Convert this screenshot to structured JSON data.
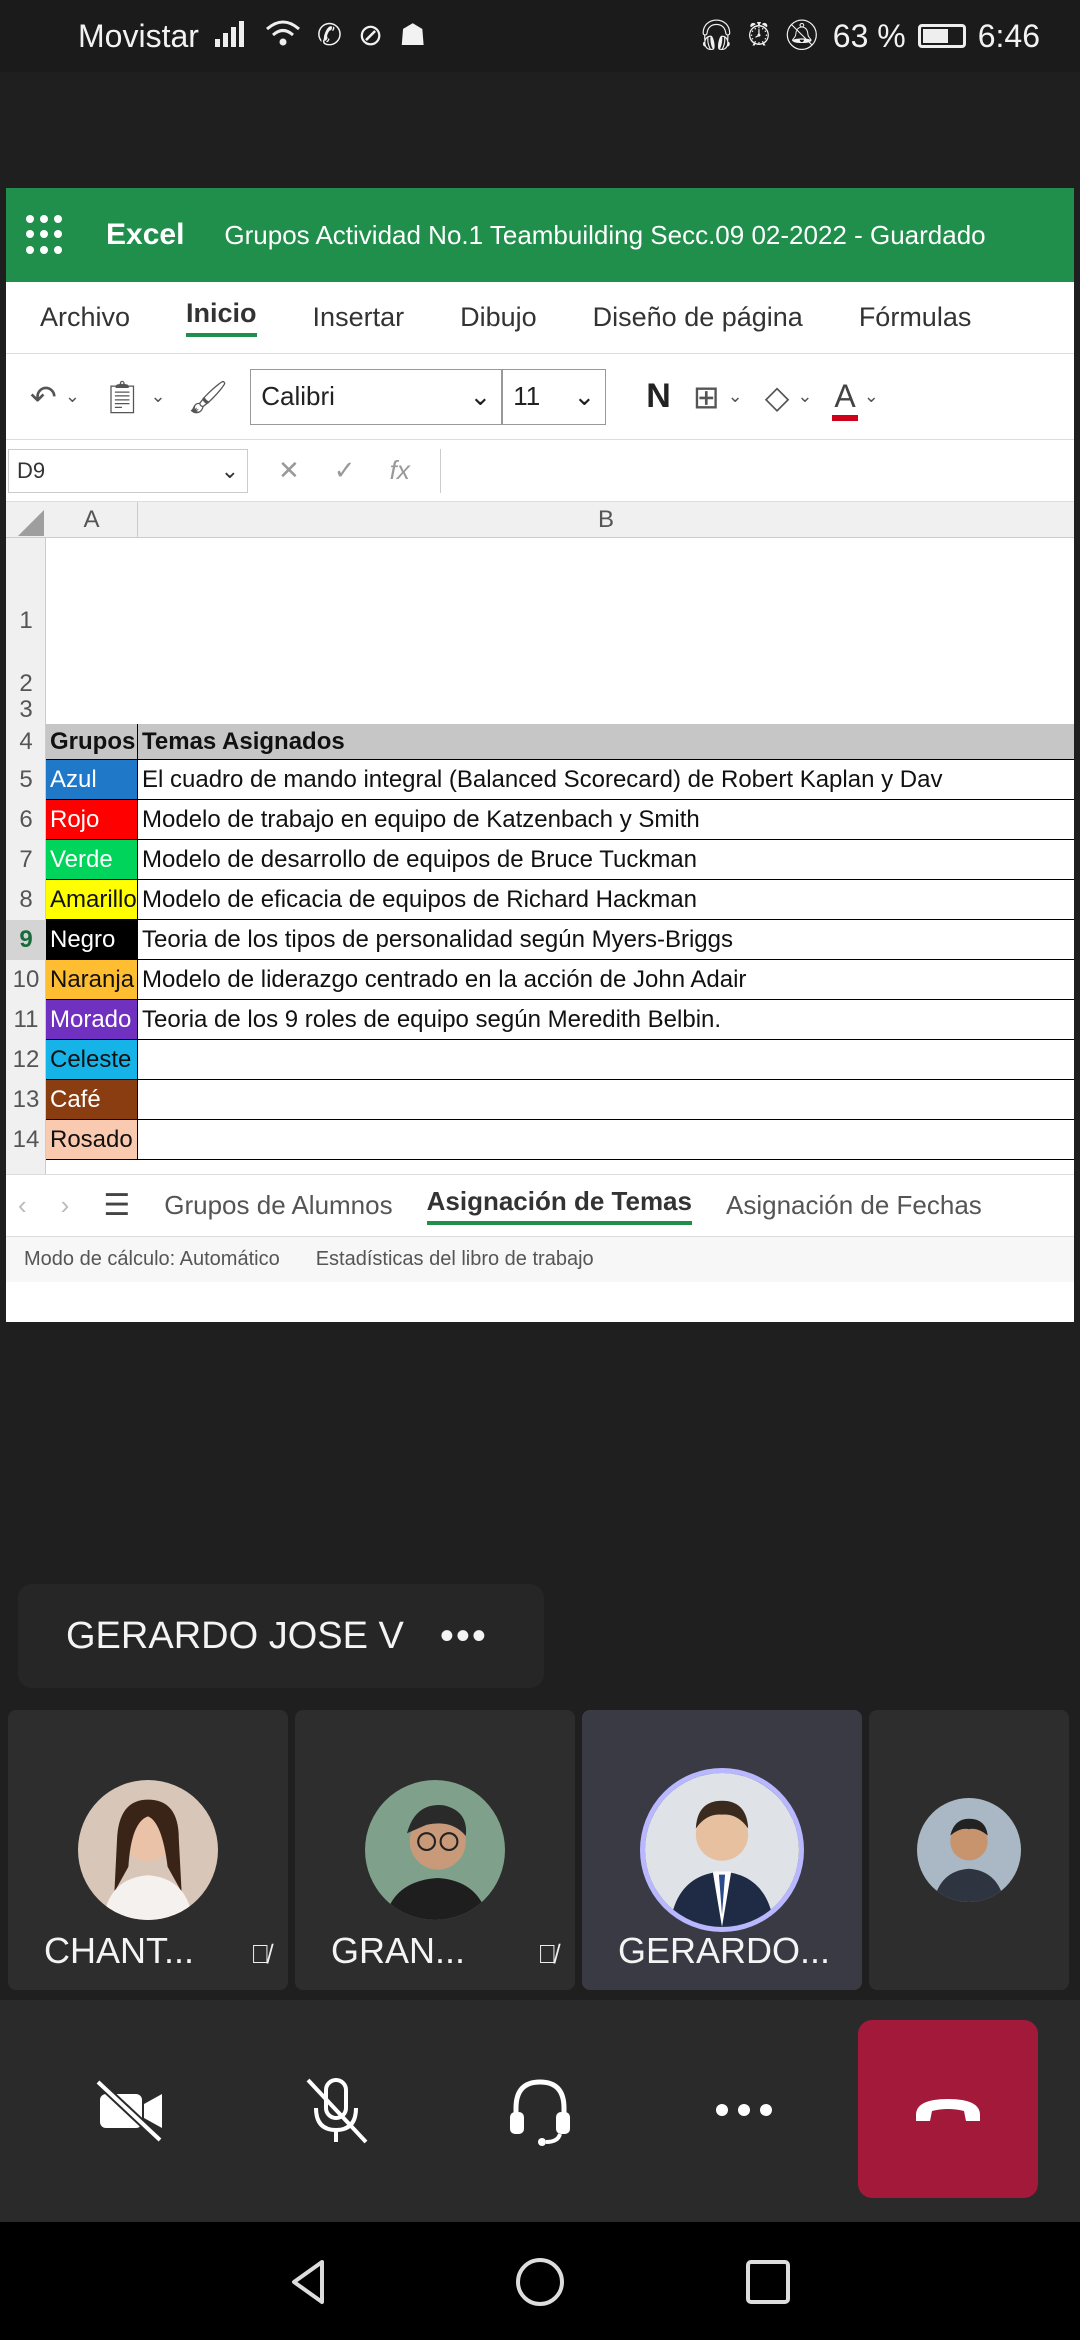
{
  "statusbar": {
    "carrier": "Movistar",
    "battery": "63 %",
    "battery_level": 0.63,
    "time": "6:46"
  },
  "excel": {
    "app_name": "Excel",
    "doc_title": "Grupos Actividad No.1 Teambuilding Secc.09 02-2022  -  Guardado",
    "ribbon_tabs": [
      "Archivo",
      "Inicio",
      "Insertar",
      "Dibujo",
      "Diseño de página",
      "Fórmulas"
    ],
    "active_tab": "Inicio",
    "font": "Calibri",
    "font_size": "11",
    "bold_label": "N",
    "fontcolor_label": "A",
    "name_box": "D9",
    "fx_label": "fx",
    "columns": [
      "A",
      "B"
    ],
    "row_numbers": [
      "1",
      "2",
      "3",
      "4",
      "5",
      "6",
      "7",
      "8",
      "9",
      "10",
      "11",
      "12",
      "13",
      "14"
    ],
    "selected_row": "9",
    "header": {
      "a": "Grupos",
      "b": "Temas Asignados"
    },
    "rows": [
      {
        "group": "Azul",
        "color": "#1f78c8",
        "text_color": "#ffffff",
        "topic": "El cuadro de mando integral (Balanced Scorecard) de Robert Kaplan y Dav"
      },
      {
        "group": "Rojo",
        "color": "#ff0000",
        "text_color": "#ffffff",
        "topic": "Modelo de trabajo en equipo de Katzenbach y Smith"
      },
      {
        "group": "Verde",
        "color": "#00d45a",
        "text_color": "#ffffff",
        "topic": "Modelo de desarrollo de equipos de Bruce Tuckman"
      },
      {
        "group": "Amarillo",
        "color": "#ffff00",
        "text_color": "#111111",
        "topic": "Modelo de eficacia de equipos de Richard Hackman"
      },
      {
        "group": "Negro",
        "color": "#000000",
        "text_color": "#ffffff",
        "topic": "Teoria de los tipos de personalidad según Myers-Briggs"
      },
      {
        "group": "Naranja",
        "color": "#ffbe32",
        "text_color": "#111111",
        "topic": "Modelo de liderazgo centrado en la acción de John Adair"
      },
      {
        "group": "Morado",
        "color": "#7030c0",
        "text_color": "#ffffff",
        "topic": "Teoria de los 9 roles de equipo según Meredith Belbin."
      },
      {
        "group": "Celeste",
        "color": "#15b3e8",
        "text_color": "#111111",
        "topic": ""
      },
      {
        "group": "Café",
        "color": "#8a3d10",
        "text_color": "#ffffff",
        "topic": ""
      },
      {
        "group": "Rosado",
        "color": "#f9c9b0",
        "text_color": "#111111",
        "topic": ""
      }
    ],
    "sheet_tabs": [
      "Grupos de Alumnos",
      "Asignación de Temas",
      "Asignación de Fechas"
    ],
    "active_sheet": "Asignación de Temas",
    "status_items": [
      "Modo de cálculo: Automático",
      "Estadísticas del libro de trabajo"
    ]
  },
  "presenter": {
    "name": "GERARDO JOSE V",
    "more": "•••"
  },
  "participants": [
    {
      "name": "CHANT...",
      "muted": true
    },
    {
      "name": "GRAN...",
      "muted": true
    },
    {
      "name": "GERARDO...",
      "muted": false,
      "speaking": true
    },
    {
      "name": "",
      "muted": false
    }
  ],
  "colors": {
    "excel_green": "#1f8f4b",
    "hangup_red": "#a3193a",
    "speaker_ring": "#b9b7ff"
  }
}
